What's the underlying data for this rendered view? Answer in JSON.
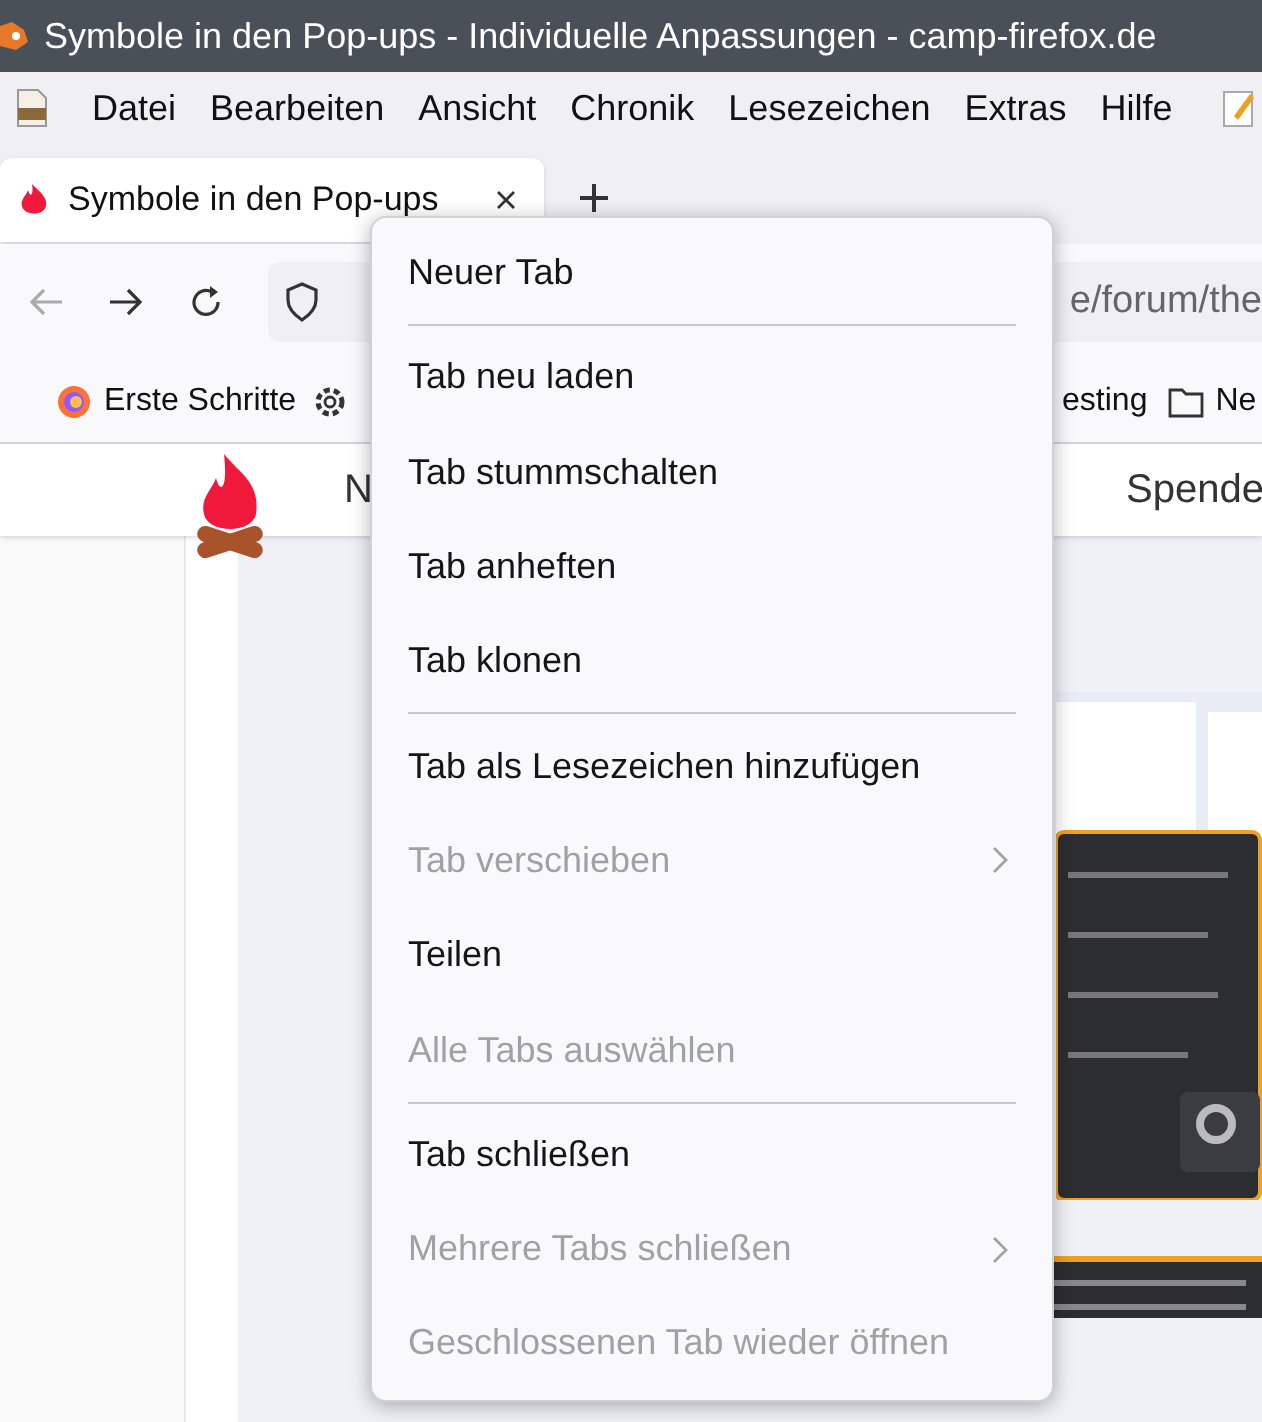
{
  "window": {
    "title": "Symbole in den Pop-ups - Individuelle Anpassungen - camp-firefox.de"
  },
  "menu_bar": [
    {
      "label": "Datei"
    },
    {
      "label": "Bearbeiten"
    },
    {
      "label": "Ansicht"
    },
    {
      "label": "Chronik"
    },
    {
      "label": "Lesezeichen"
    },
    {
      "label": "Extras"
    },
    {
      "label": "Hilfe"
    }
  ],
  "tabs": [
    {
      "title": "Symbole in den Pop-ups",
      "selected": true
    }
  ],
  "address_bar": {
    "url": "e/forum/the"
  },
  "bookmarks": [
    {
      "kind": "firefox",
      "label": "Erste Schritte"
    },
    {
      "kind": "gear"
    },
    {
      "kind": "plain",
      "label": "esting"
    },
    {
      "kind": "folder",
      "label": "Ne"
    }
  ],
  "page_header": {
    "nav": [
      "N",
      "Spende"
    ]
  },
  "context_menu": [
    {
      "kind": "item",
      "label": "Neuer Tab",
      "disabled": false,
      "submenu": false
    },
    {
      "kind": "separator"
    },
    {
      "kind": "item",
      "label": "Tab neu laden",
      "disabled": false,
      "submenu": false
    },
    {
      "kind": "item",
      "label": "Tab stummschalten",
      "disabled": false,
      "submenu": false
    },
    {
      "kind": "item",
      "label": "Tab anheften",
      "disabled": false,
      "submenu": false
    },
    {
      "kind": "item",
      "label": "Tab klonen",
      "disabled": false,
      "submenu": false
    },
    {
      "kind": "separator"
    },
    {
      "kind": "item",
      "label": "Tab als Lesezeichen hinzufügen",
      "disabled": false,
      "submenu": false
    },
    {
      "kind": "item",
      "label": "Tab verschieben",
      "disabled": true,
      "submenu": true
    },
    {
      "kind": "item",
      "label": "Teilen",
      "disabled": false,
      "submenu": false
    },
    {
      "kind": "item",
      "label": "Alle Tabs auswählen",
      "disabled": true,
      "submenu": false
    },
    {
      "kind": "separator"
    },
    {
      "kind": "item",
      "label": "Tab schließen",
      "disabled": false,
      "submenu": false
    },
    {
      "kind": "item",
      "label": "Mehrere Tabs schließen",
      "disabled": true,
      "submenu": true
    },
    {
      "kind": "item",
      "label": "Geschlossenen Tab wieder öffnen",
      "disabled": true,
      "submenu": false
    }
  ]
}
